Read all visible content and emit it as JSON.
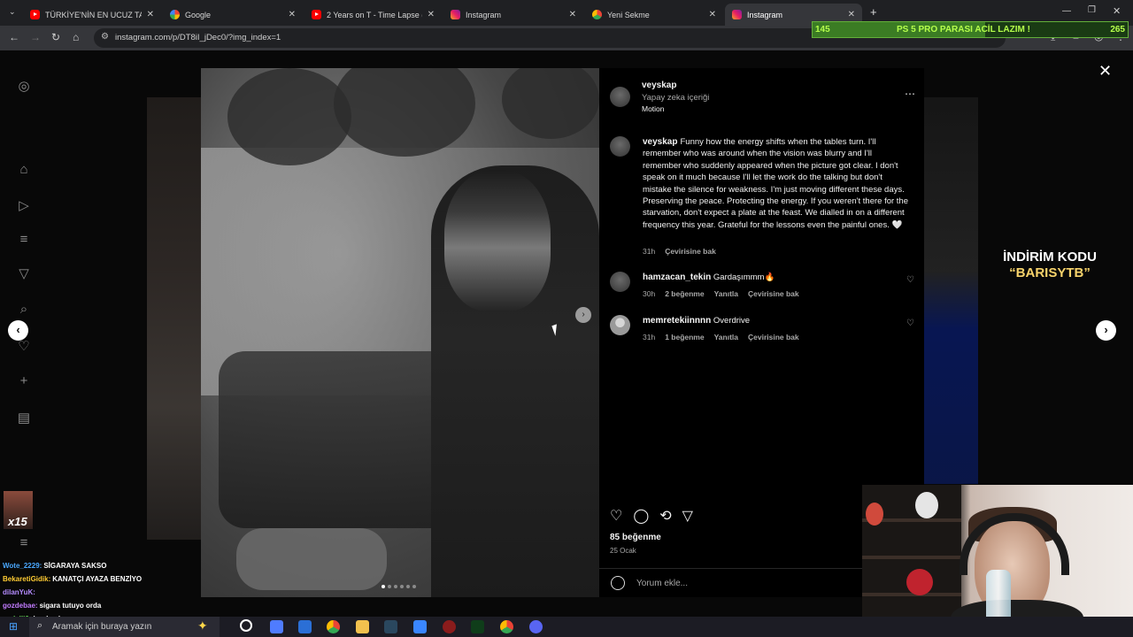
{
  "browser": {
    "tabs": [
      {
        "title": "TÜRKİYE'NİN EN UCUZ TAVUK",
        "favicon": "youtube-icon",
        "active": false
      },
      {
        "title": "Google",
        "favicon": "google-icon",
        "active": false
      },
      {
        "title": "2 Years on T - Time Lapse (FTM",
        "favicon": "youtube-icon",
        "active": false
      },
      {
        "title": "Instagram",
        "favicon": "instagram-icon",
        "active": false
      },
      {
        "title": "Yeni Sekme",
        "favicon": "chrome-icon",
        "active": false
      },
      {
        "title": "Instagram",
        "favicon": "instagram-icon",
        "active": true
      }
    ],
    "url": "instagram.com/p/DT8iI_jDec0/?img_index=1"
  },
  "stream_goal": {
    "current": "145",
    "target": "265",
    "label": "PS 5 PRO PARASI ACİL LAZIM !",
    "progress": 0.547
  },
  "post": {
    "username": "veyskap",
    "ai_label": "Yapay zeka içeriği",
    "audio": "Motion",
    "caption_user": "veyskap",
    "caption_text": "Funny how the energy shifts when the tables turn. I'll remember who was around when the vision was blurry and I'll remember who suddenly appeared when the picture got clear. I don't speak on it much because I'll let the work do the talking but don't mistake the silence for weakness. I'm just moving different these days. Preserving the peace. Protecting the energy. If you weren't there for the starvation, don't expect a plate at the feast. We dialled in on a different frequency this year. Grateful for the lessons even the painful ones.",
    "caption_emoji": "🤍",
    "caption_time": "31h",
    "caption_translate": "Çevirisine bak",
    "comments": [
      {
        "user": "hamzacan_tekin",
        "text": "Gardaşımmm🔥",
        "time": "30h",
        "likes": "2 beğenme",
        "reply": "Yanıtla",
        "translate": "Çevirisine bak"
      },
      {
        "user": "memretekiinnnn",
        "text": "Overdrive",
        "time": "31h",
        "likes": "1 beğenme",
        "reply": "Yanıtla",
        "translate": "Çevirisine bak"
      }
    ],
    "likes": "85 beğenme",
    "date": "25 Ocak",
    "comment_placeholder": "Yorum ekle...",
    "image_count": 6,
    "image_index": 1
  },
  "promo": {
    "line1": "İNDİRİM KODU",
    "line2": "“BARISYTB”"
  },
  "side_count": "x15",
  "chat": [
    {
      "user": "Wote_2229",
      "text": "SİGARAYA SAKSO",
      "color": "#4aa8ff"
    },
    {
      "user": "BekaretiGidik",
      "text": "KANATÇI AYAZA BENZİYO",
      "color": "#ffcc33"
    },
    {
      "user": "dilanYuK",
      "text": "",
      "color": "#b58cff"
    },
    {
      "user": "gozdebae",
      "text": "sigara tutuyo orda",
      "color": "#c27bff"
    },
    {
      "user": "sudelli0",
      "text": "bu da okey",
      "color": "#66dd55"
    }
  ],
  "taskbar": {
    "search_placeholder": "Aramak için buraya yazın"
  }
}
